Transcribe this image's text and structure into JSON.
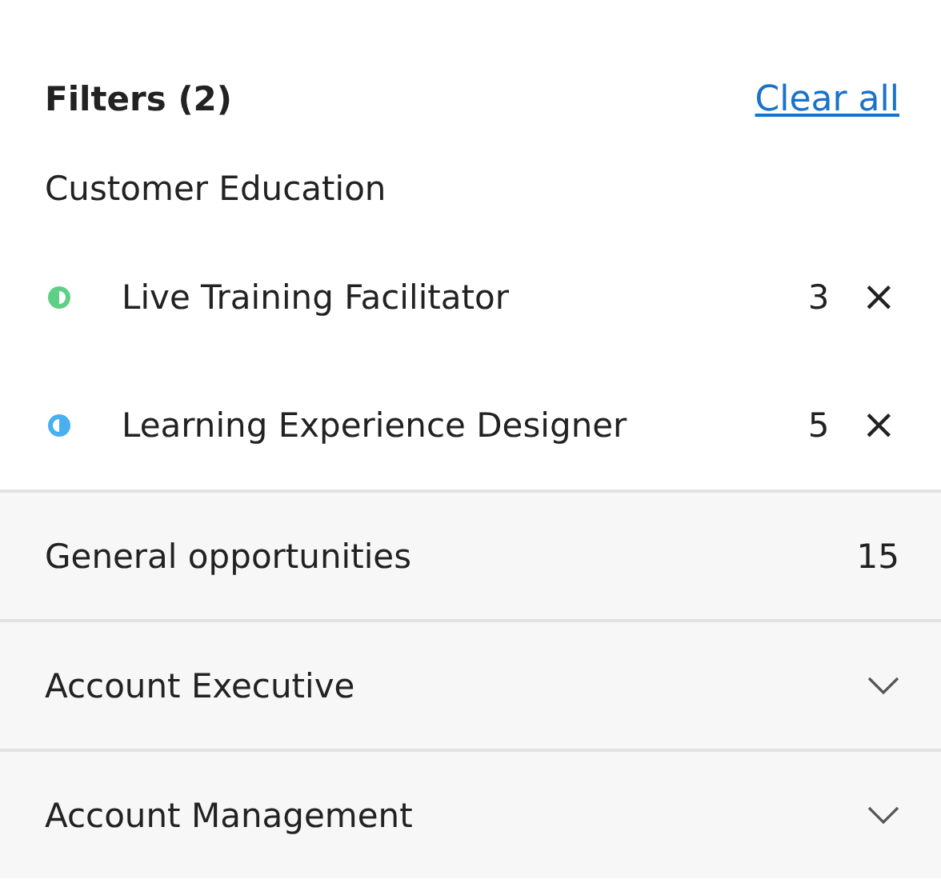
{
  "header": {
    "title": "Filters (2)",
    "clear_link": "Clear all"
  },
  "group": {
    "label": "Customer Education",
    "items": [
      {
        "label": "Live Training Facilitator",
        "count": "3",
        "remove": "×",
        "color": "#5fcf87",
        "kind": "left-half"
      },
      {
        "label": "Learning Experience Designer",
        "count": "5",
        "remove": "×",
        "color": "#48aff0",
        "kind": "right-half"
      }
    ]
  },
  "sections": [
    {
      "label": "General opportunities",
      "kind": "count",
      "count": "15"
    },
    {
      "label": "Account Executive",
      "kind": "collapsible",
      "expanded": false
    },
    {
      "label": "Account Management",
      "kind": "collapsible",
      "expanded": false
    }
  ]
}
